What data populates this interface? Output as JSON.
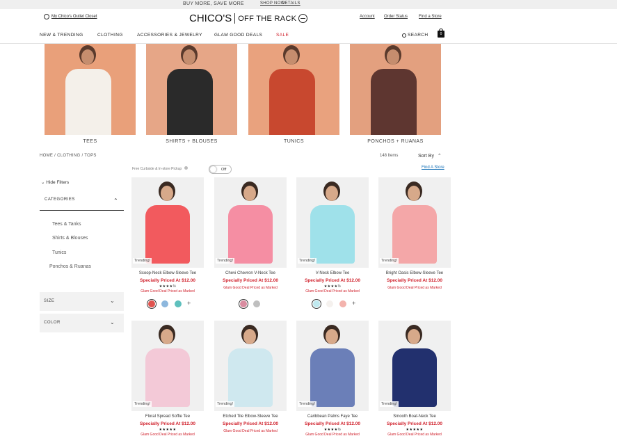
{
  "promo": {
    "message": "BUY MORE, SAVE MORE",
    "shop_now": "SHOP NOW",
    "details": "DETAILS"
  },
  "header": {
    "closet_link": "My Chico's Outlet Closet",
    "logo_brand": "CHICO'S",
    "logo_sub": "OFF THE RACK",
    "account": "Account",
    "order_status": "Order Status",
    "find_store": "Find a Store",
    "bag_count": "0"
  },
  "nav": {
    "items": [
      "NEW & TRENDING",
      "CLOTHING",
      "ACCESSORIES & JEWELRY",
      "GLAM GOOD DEALS",
      "SALE"
    ],
    "search": "SEARCH"
  },
  "categories": [
    "TEES",
    "SHIRTS + BLOUSES",
    "TUNICS",
    "PONCHOS + RUANAS"
  ],
  "breadcrumb": "HOME  /  CLOTHING  /  TOPS",
  "item_count": "148 Items",
  "sort_label": "Sort By",
  "find_a_store": "Find A Store",
  "pickup_label": "Free Curbside & In-store Pickup",
  "toggle_label": "Off",
  "hide_filters": "Hide Filters",
  "filters": {
    "categories_title": "CATEGORIES",
    "category_links": [
      "Tees & Tanks",
      "Shirts & Blouses",
      "Tunics",
      "Ponchos & Ruanas"
    ],
    "size": "SIZE",
    "color": "COLOR"
  },
  "products": [
    {
      "name": "Scoop-Neck Elbow-Sleeve Tee",
      "price": "Specially Priced At $12.00",
      "badge": "Trending!",
      "stars": "★★★★½",
      "glam": "Glam Good Deal Priced as Marked",
      "color": "#f25a5e",
      "swatches": [
        "#e0544f",
        "#8db7dd",
        "#5fc0bd"
      ],
      "plus": "+"
    },
    {
      "name": "Chevi Chevron V-Neck Tee",
      "price": "Specially Priced At $12.00",
      "badge": "Trending!",
      "stars": "",
      "glam": "Glam Good Deal Priced as Marked",
      "color": "#f58ea3",
      "swatches": [
        "#d98ca0",
        "#bfbfbf"
      ],
      "plus": ""
    },
    {
      "name": "V-Neck Elbow Tee",
      "price": "Specially Priced At $12.00",
      "badge": "Trending!",
      "stars": "★★★★½",
      "glam": "Glam Good Deal Priced as Marked",
      "color": "#9fe1ea",
      "swatches": [
        "#bfe9ef",
        "#f5f1ee",
        "#f3b3ad"
      ],
      "plus": "+"
    },
    {
      "name": "Bright Oasis Elbow-Sleeve Tee",
      "price": "Specially Priced At $12.00",
      "badge": "Trending!",
      "stars": "",
      "glam": "Glam Good Deal Priced as Marked",
      "color": "#f4a7a8",
      "swatches": [],
      "plus": ""
    },
    {
      "name": "Floral Spread Soffie Tee",
      "price": "Specially Priced At $12.00",
      "badge": "Trending!",
      "stars": "★★★★★",
      "glam": "Glam Good Deal Priced as Marked",
      "color": "#f3c9d7",
      "swatches": [],
      "plus": ""
    },
    {
      "name": "Etched Tile Elbow-Sleeve Tee",
      "price": "Specially Priced At $12.00",
      "badge": "Trending!",
      "stars": "",
      "glam": "Glam Good Deal Priced as Marked",
      "color": "#cfe8ef",
      "swatches": [],
      "plus": ""
    },
    {
      "name": "Caribbean Palms Faye Tee",
      "price": "Specially Priced At $12.00",
      "badge": "Trending!",
      "stars": "★★★★½",
      "glam": "Glam Good Deal Priced as Marked",
      "color": "#6b7fb8",
      "swatches": [],
      "plus": ""
    },
    {
      "name": "Smooth Boat-Neck Tee",
      "price": "Specially Priced At $12.00",
      "badge": "Trending!",
      "stars": "★★★★★",
      "glam": "Glam Good Deal Priced as Marked",
      "color": "#22306e",
      "swatches": [],
      "plus": ""
    }
  ],
  "category_colors": [
    "#e9a07a",
    "#e6a687",
    "#e9a27e",
    "#e3a07f"
  ],
  "category_garment_colors": [
    "#f4f0ea",
    "#2a2a2a",
    "#c8482f",
    "#5e3630"
  ]
}
